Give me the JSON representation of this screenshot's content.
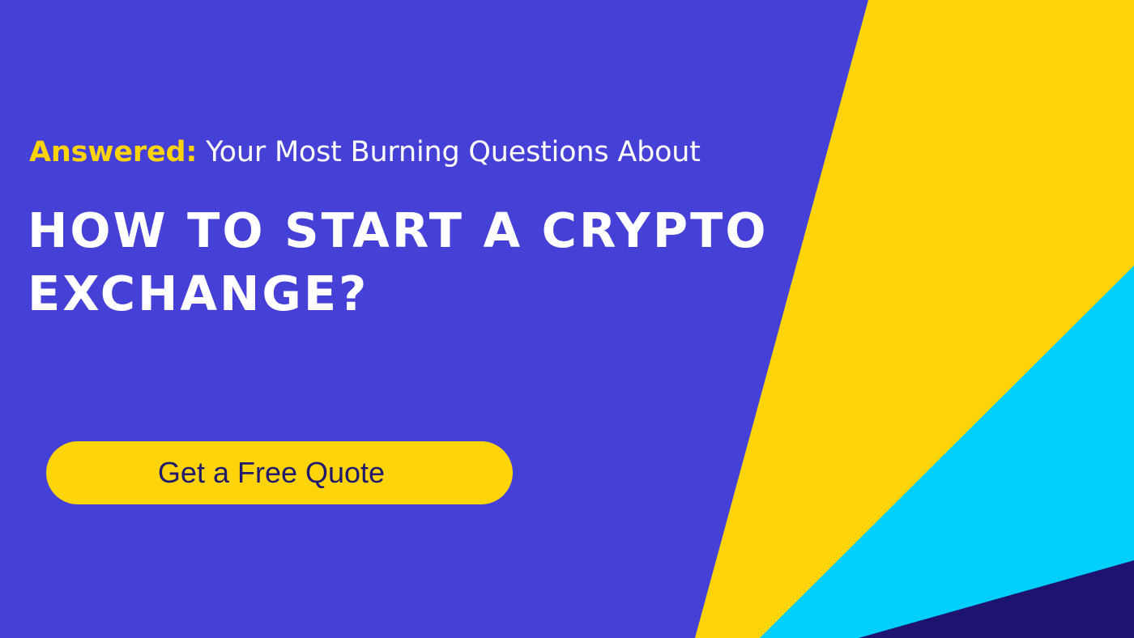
{
  "banner": {
    "subtitle_accent": "Answered:",
    "subtitle_rest": " Your Most Burning Questions About",
    "headline_line1": "HOW TO START A CRYPTO",
    "headline_line2": "EXCHANGE?",
    "cta_label": "Get a Free Quote"
  },
  "colors": {
    "background": "#4641d6",
    "accent_yellow": "#fdd40a",
    "accent_cyan": "#00cffc",
    "dark_navy": "#1e1470",
    "text_white": "#ffffff",
    "cta_text": "#1f1a6b"
  }
}
